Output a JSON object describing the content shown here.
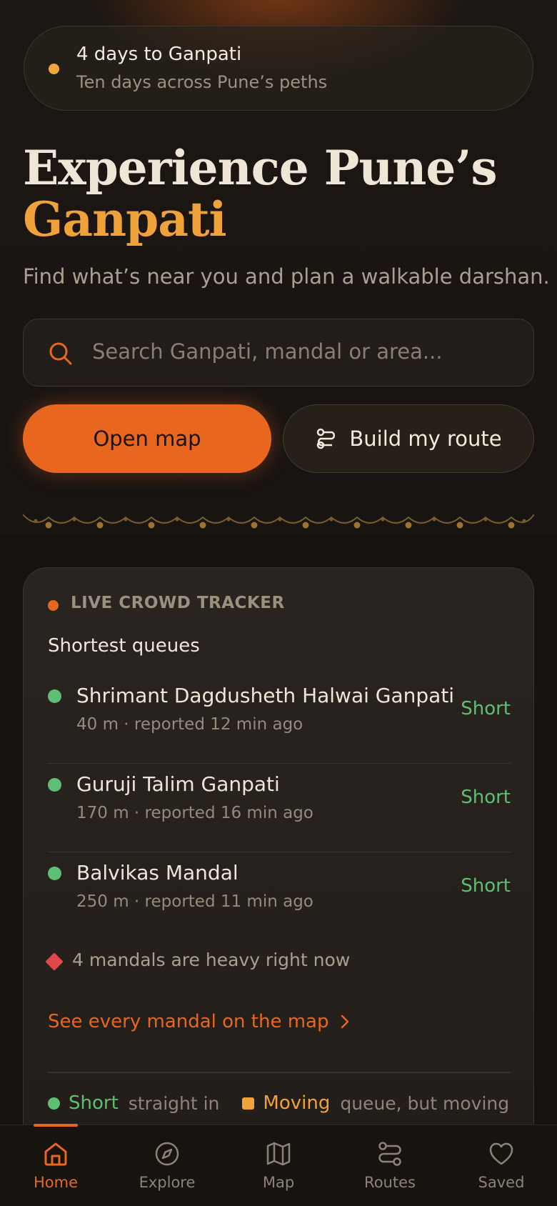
{
  "countdown": {
    "title": "4 days to Ganpati",
    "subtitle": "Ten days across Pune’s peths"
  },
  "hero": {
    "title_line1": "Experience Pune’s",
    "title_line2": "Ganpati",
    "subtitle": "Find what’s near you and plan a walkable darshan."
  },
  "search": {
    "placeholder": "Search Ganpati, mandal or area..."
  },
  "actions": {
    "open_map": "Open map",
    "build_route": "Build my route"
  },
  "crowd": {
    "label": "LIVE CROWD TRACKER",
    "heading": "Shortest queues",
    "rows": [
      {
        "name": "Shrimant Dagdusheth Halwai Ganpati",
        "meta": "40 m · reported 12 min ago",
        "status": "Short"
      },
      {
        "name": "Guruji Talim Ganpati",
        "meta": "170 m · reported 16 min ago",
        "status": "Short"
      },
      {
        "name": "Balvikas Mandal",
        "meta": "250 m · reported 11 min ago",
        "status": "Short"
      }
    ],
    "heavy_note": "4 mandals are heavy right now",
    "see_all": "See every mandal on the map",
    "legend": {
      "short_label": "Short",
      "short_desc": "straight in",
      "moving_label": "Moving",
      "moving_desc": "queue, but moving"
    }
  },
  "nav": {
    "items": [
      {
        "label": "Home",
        "icon": "home-icon",
        "active": true
      },
      {
        "label": "Explore",
        "icon": "compass-icon",
        "active": false
      },
      {
        "label": "Map",
        "icon": "map-icon",
        "active": false
      },
      {
        "label": "Routes",
        "icon": "route-icon",
        "active": false
      },
      {
        "label": "Saved",
        "icon": "heart-icon",
        "active": false
      }
    ]
  },
  "colors": {
    "accent": "#e8661e",
    "gold": "#f0a23a",
    "short": "#5dbf73",
    "heavy": "#e0474a",
    "background": "#151210"
  }
}
